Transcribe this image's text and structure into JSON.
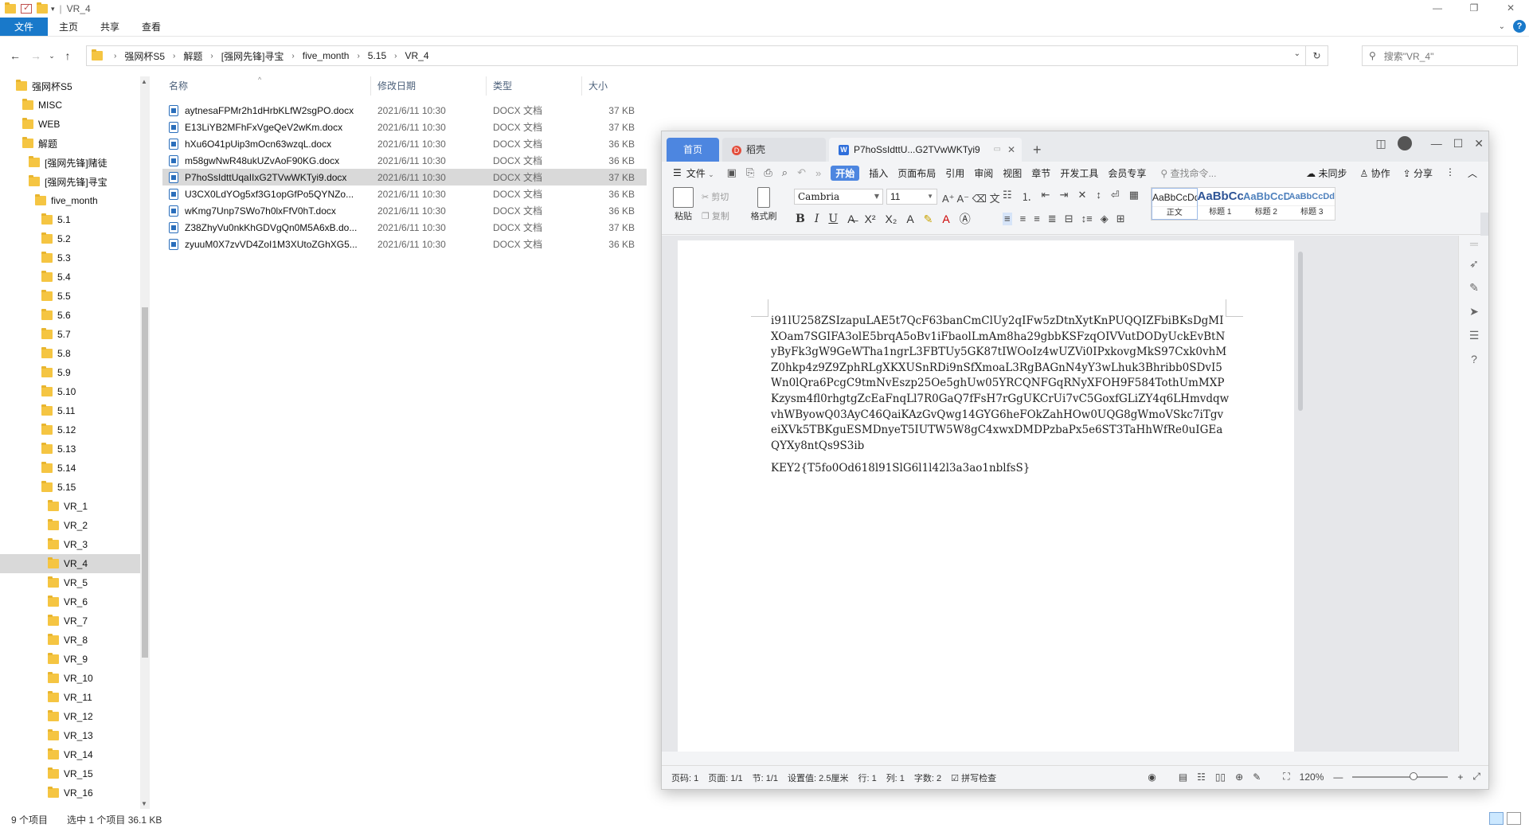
{
  "explorer": {
    "window_title": "VR_4",
    "ribbon_tabs": [
      "文件",
      "主页",
      "共享",
      "查看"
    ],
    "help": "?",
    "breadcrumbs": [
      "强网杯S5",
      "解题",
      "[强网先锋]寻宝",
      "five_month",
      "5.15",
      "VR_4"
    ],
    "search_placeholder": "搜索\"VR_4\"",
    "nav_tree": [
      {
        "label": "强网杯S5",
        "indent": 0
      },
      {
        "label": "MISC",
        "indent": 1
      },
      {
        "label": "WEB",
        "indent": 1
      },
      {
        "label": "解题",
        "indent": 1
      },
      {
        "label": "[强网先锋]赌徒",
        "indent": 2
      },
      {
        "label": "[强网先锋]寻宝",
        "indent": 2
      },
      {
        "label": "five_month",
        "indent": 3
      },
      {
        "label": "5.1",
        "indent": 4
      },
      {
        "label": "5.2",
        "indent": 4
      },
      {
        "label": "5.3",
        "indent": 4
      },
      {
        "label": "5.4",
        "indent": 4
      },
      {
        "label": "5.5",
        "indent": 4
      },
      {
        "label": "5.6",
        "indent": 4
      },
      {
        "label": "5.7",
        "indent": 4
      },
      {
        "label": "5.8",
        "indent": 4
      },
      {
        "label": "5.9",
        "indent": 4
      },
      {
        "label": "5.10",
        "indent": 4
      },
      {
        "label": "5.11",
        "indent": 4
      },
      {
        "label": "5.12",
        "indent": 4
      },
      {
        "label": "5.13",
        "indent": 4
      },
      {
        "label": "5.14",
        "indent": 4
      },
      {
        "label": "5.15",
        "indent": 4
      },
      {
        "label": "VR_1",
        "indent": 5
      },
      {
        "label": "VR_2",
        "indent": 5
      },
      {
        "label": "VR_3",
        "indent": 5
      },
      {
        "label": "VR_4",
        "indent": 5
      },
      {
        "label": "VR_5",
        "indent": 5
      },
      {
        "label": "VR_6",
        "indent": 5
      },
      {
        "label": "VR_7",
        "indent": 5
      },
      {
        "label": "VR_8",
        "indent": 5
      },
      {
        "label": "VR_9",
        "indent": 5
      },
      {
        "label": "VR_10",
        "indent": 5
      },
      {
        "label": "VR_11",
        "indent": 5
      },
      {
        "label": "VR_12",
        "indent": 5
      },
      {
        "label": "VR_13",
        "indent": 5
      },
      {
        "label": "VR_14",
        "indent": 5
      },
      {
        "label": "VR_15",
        "indent": 5
      },
      {
        "label": "VR_16",
        "indent": 5
      }
    ],
    "selected_nav": "VR_4",
    "columns": [
      "名称",
      "修改日期",
      "类型",
      "大小"
    ],
    "files": [
      {
        "name": "aytnesaFPMr2h1dHrbKLfW2sgPO.docx",
        "date": "2021/6/11 10:30",
        "type": "DOCX 文档",
        "size": "37 KB"
      },
      {
        "name": "E13LiYB2MFhFxVgeQeV2wKm.docx",
        "date": "2021/6/11 10:30",
        "type": "DOCX 文档",
        "size": "37 KB"
      },
      {
        "name": "hXu6O41pUip3mOcn63wzqL.docx",
        "date": "2021/6/11 10:30",
        "type": "DOCX 文档",
        "size": "36 KB"
      },
      {
        "name": "m58gwNwR48ukUZvAoF90KG.docx",
        "date": "2021/6/11 10:30",
        "type": "DOCX 文档",
        "size": "36 KB"
      },
      {
        "name": "P7hoSsIdttUqaIIxG2TVwWKTyi9.docx",
        "date": "2021/6/11 10:30",
        "type": "DOCX 文档",
        "size": "37 KB",
        "selected": true
      },
      {
        "name": "U3CX0LdYOg5xf3G1opGfPo5QYNZo...",
        "date": "2021/6/11 10:30",
        "type": "DOCX 文档",
        "size": "36 KB"
      },
      {
        "name": "wKmg7Unp7SWo7h0lxFfV0hT.docx",
        "date": "2021/6/11 10:30",
        "type": "DOCX 文档",
        "size": "36 KB"
      },
      {
        "name": "Z38ZhyVu0nkKhGDVgQn0M5A6xB.do...",
        "date": "2021/6/11 10:30",
        "type": "DOCX 文档",
        "size": "37 KB"
      },
      {
        "name": "zyuuM0X7zvVD4ZoI1M3XUtoZGhXG5...",
        "date": "2021/6/11 10:30",
        "type": "DOCX 文档",
        "size": "36 KB"
      }
    ],
    "status": {
      "count": "9 个项目",
      "selected": "选中 1 个项目  36.1 KB"
    }
  },
  "wps": {
    "tabs": {
      "home": "首页",
      "straw": "稻壳",
      "doc": "P7hoSsIdttU...G2TVwWKTyi9"
    },
    "menu": [
      "文件",
      "开始",
      "插入",
      "页面布局",
      "引用",
      "审阅",
      "视图",
      "章节",
      "开发工具",
      "会员专享"
    ],
    "active_menu": "开始",
    "cmd_search": "查找命令...",
    "menu_right": [
      "未同步",
      "协作",
      "分享"
    ],
    "toolbar": {
      "paste": "粘贴",
      "cut": "剪切",
      "copy": "复制",
      "format_painter": "格式刷",
      "font_name": "Cambria",
      "font_size": "11"
    },
    "styles": [
      {
        "sample": "AaBbCcDd",
        "label": "正文"
      },
      {
        "sample": "AaBbCcI",
        "label": "标题 1"
      },
      {
        "sample": "AaBbCcD",
        "label": "标题 2"
      },
      {
        "sample": "AaBbCcDd",
        "label": "标题 3"
      }
    ],
    "document": {
      "body": "i91lU258ZSIzapuLAE5t7QcF63banCmClUy2qIFw5zDtnXytKnPUQQIZFbiBKsDgMIXOam7SGIFA3olE5brqA5oBv1iFbaolLmAm8ha29gbbKSFzqOIVVutDODyUckEvBtNyByFk3gW9GeWTha1ngrL3FBTUy5GK87tIWOoIz4wUZVi0IPxkovgMkS97Cxk0vhMZ0hkp4z9Z9ZphRLgXKXUSnRDi9nSfXmoaL3RgBAGnN4yY3wLhuk3Bhribb0SDvI5Wn0lQra6PcgC9tmNvEszp25Oe5ghUw05YRCQNFGqRNyXFOH9F584TothUmMXPKzysm4fl0rhgtgZcEaFnqLl7R0GaQ7fFsH7rGgUKCrUi7vC5GoxfGLiZY4q6LHmvdqwvhWByowQ03AyC46QaiKAzGvQwg14GYG6heFOkZahHOw0UQG8gWmoVSkc7iTgveiXVk5TBKguESMDnyeT5IUTW5W8gC4xwxDMDPzbaPx5e6ST3TaHhWfRe0uIGEaQYXy8ntQs9S3ib",
      "key": "KEY2{T5fo0Od618l91SlG6l1l42l3a3ao1nblfsS}"
    },
    "status": {
      "page": "页码: 1",
      "pages": "页面: 1/1",
      "section": "节: 1/1",
      "setting": "设置值: 2.5厘米",
      "row": "行: 1",
      "col": "列: 1",
      "words": "字数: 2",
      "spell": "拼写检查",
      "zoom": "120%"
    }
  }
}
